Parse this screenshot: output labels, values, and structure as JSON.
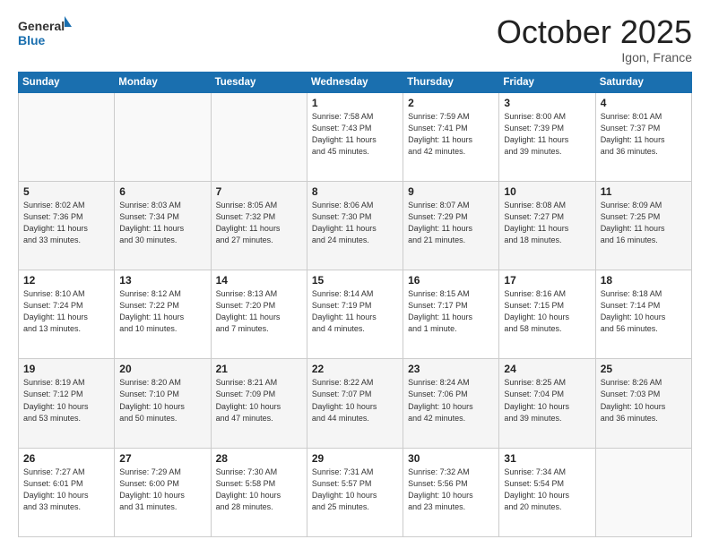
{
  "logo": {
    "line1": "General",
    "line2": "Blue"
  },
  "title": "October 2025",
  "location": "Igon, France",
  "days_of_week": [
    "Sunday",
    "Monday",
    "Tuesday",
    "Wednesday",
    "Thursday",
    "Friday",
    "Saturday"
  ],
  "weeks": [
    [
      {
        "day": "",
        "info": ""
      },
      {
        "day": "",
        "info": ""
      },
      {
        "day": "",
        "info": ""
      },
      {
        "day": "1",
        "info": "Sunrise: 7:58 AM\nSunset: 7:43 PM\nDaylight: 11 hours\nand 45 minutes."
      },
      {
        "day": "2",
        "info": "Sunrise: 7:59 AM\nSunset: 7:41 PM\nDaylight: 11 hours\nand 42 minutes."
      },
      {
        "day": "3",
        "info": "Sunrise: 8:00 AM\nSunset: 7:39 PM\nDaylight: 11 hours\nand 39 minutes."
      },
      {
        "day": "4",
        "info": "Sunrise: 8:01 AM\nSunset: 7:37 PM\nDaylight: 11 hours\nand 36 minutes."
      }
    ],
    [
      {
        "day": "5",
        "info": "Sunrise: 8:02 AM\nSunset: 7:36 PM\nDaylight: 11 hours\nand 33 minutes."
      },
      {
        "day": "6",
        "info": "Sunrise: 8:03 AM\nSunset: 7:34 PM\nDaylight: 11 hours\nand 30 minutes."
      },
      {
        "day": "7",
        "info": "Sunrise: 8:05 AM\nSunset: 7:32 PM\nDaylight: 11 hours\nand 27 minutes."
      },
      {
        "day": "8",
        "info": "Sunrise: 8:06 AM\nSunset: 7:30 PM\nDaylight: 11 hours\nand 24 minutes."
      },
      {
        "day": "9",
        "info": "Sunrise: 8:07 AM\nSunset: 7:29 PM\nDaylight: 11 hours\nand 21 minutes."
      },
      {
        "day": "10",
        "info": "Sunrise: 8:08 AM\nSunset: 7:27 PM\nDaylight: 11 hours\nand 18 minutes."
      },
      {
        "day": "11",
        "info": "Sunrise: 8:09 AM\nSunset: 7:25 PM\nDaylight: 11 hours\nand 16 minutes."
      }
    ],
    [
      {
        "day": "12",
        "info": "Sunrise: 8:10 AM\nSunset: 7:24 PM\nDaylight: 11 hours\nand 13 minutes."
      },
      {
        "day": "13",
        "info": "Sunrise: 8:12 AM\nSunset: 7:22 PM\nDaylight: 11 hours\nand 10 minutes."
      },
      {
        "day": "14",
        "info": "Sunrise: 8:13 AM\nSunset: 7:20 PM\nDaylight: 11 hours\nand 7 minutes."
      },
      {
        "day": "15",
        "info": "Sunrise: 8:14 AM\nSunset: 7:19 PM\nDaylight: 11 hours\nand 4 minutes."
      },
      {
        "day": "16",
        "info": "Sunrise: 8:15 AM\nSunset: 7:17 PM\nDaylight: 11 hours\nand 1 minute."
      },
      {
        "day": "17",
        "info": "Sunrise: 8:16 AM\nSunset: 7:15 PM\nDaylight: 10 hours\nand 58 minutes."
      },
      {
        "day": "18",
        "info": "Sunrise: 8:18 AM\nSunset: 7:14 PM\nDaylight: 10 hours\nand 56 minutes."
      }
    ],
    [
      {
        "day": "19",
        "info": "Sunrise: 8:19 AM\nSunset: 7:12 PM\nDaylight: 10 hours\nand 53 minutes."
      },
      {
        "day": "20",
        "info": "Sunrise: 8:20 AM\nSunset: 7:10 PM\nDaylight: 10 hours\nand 50 minutes."
      },
      {
        "day": "21",
        "info": "Sunrise: 8:21 AM\nSunset: 7:09 PM\nDaylight: 10 hours\nand 47 minutes."
      },
      {
        "day": "22",
        "info": "Sunrise: 8:22 AM\nSunset: 7:07 PM\nDaylight: 10 hours\nand 44 minutes."
      },
      {
        "day": "23",
        "info": "Sunrise: 8:24 AM\nSunset: 7:06 PM\nDaylight: 10 hours\nand 42 minutes."
      },
      {
        "day": "24",
        "info": "Sunrise: 8:25 AM\nSunset: 7:04 PM\nDaylight: 10 hours\nand 39 minutes."
      },
      {
        "day": "25",
        "info": "Sunrise: 8:26 AM\nSunset: 7:03 PM\nDaylight: 10 hours\nand 36 minutes."
      }
    ],
    [
      {
        "day": "26",
        "info": "Sunrise: 7:27 AM\nSunset: 6:01 PM\nDaylight: 10 hours\nand 33 minutes."
      },
      {
        "day": "27",
        "info": "Sunrise: 7:29 AM\nSunset: 6:00 PM\nDaylight: 10 hours\nand 31 minutes."
      },
      {
        "day": "28",
        "info": "Sunrise: 7:30 AM\nSunset: 5:58 PM\nDaylight: 10 hours\nand 28 minutes."
      },
      {
        "day": "29",
        "info": "Sunrise: 7:31 AM\nSunset: 5:57 PM\nDaylight: 10 hours\nand 25 minutes."
      },
      {
        "day": "30",
        "info": "Sunrise: 7:32 AM\nSunset: 5:56 PM\nDaylight: 10 hours\nand 23 minutes."
      },
      {
        "day": "31",
        "info": "Sunrise: 7:34 AM\nSunset: 5:54 PM\nDaylight: 10 hours\nand 20 minutes."
      },
      {
        "day": "",
        "info": ""
      }
    ]
  ]
}
